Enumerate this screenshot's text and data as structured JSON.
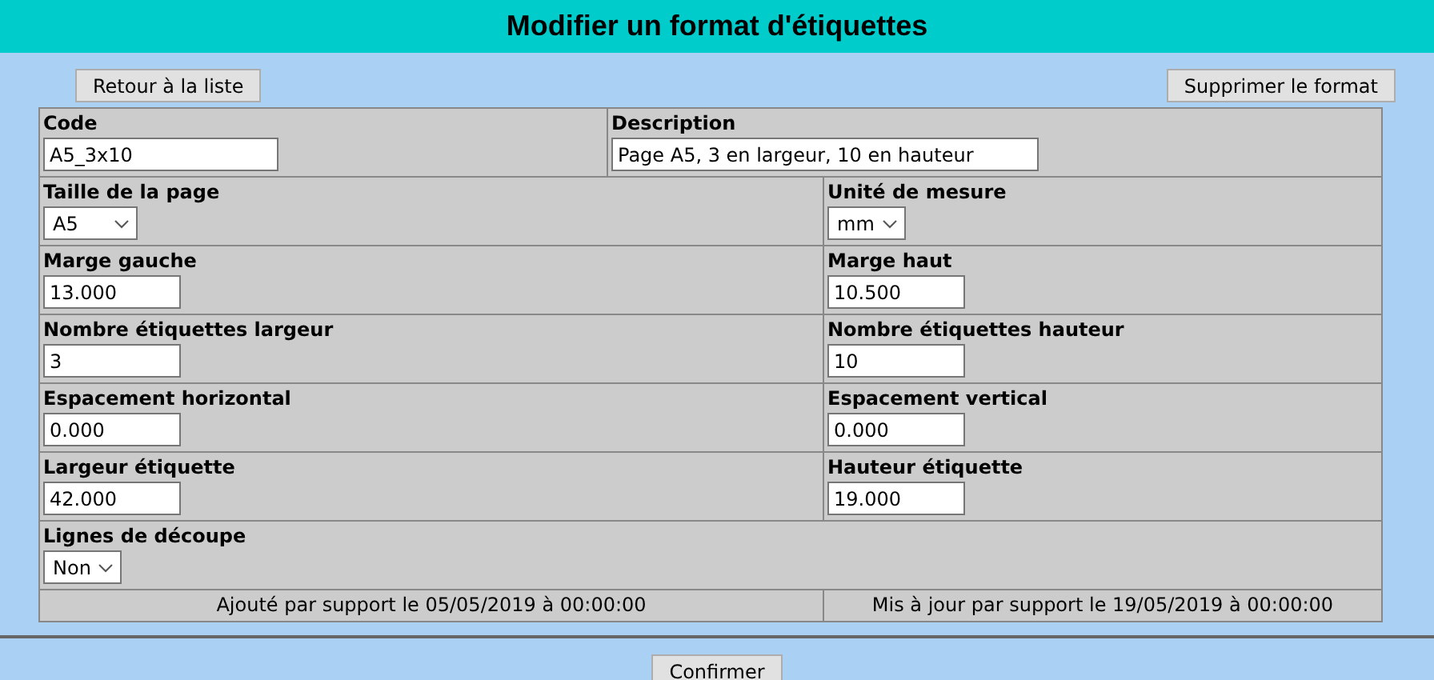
{
  "title": "Modifier un format d'étiquettes",
  "back_button": "Retour à la liste",
  "delete_button": "Supprimer le format",
  "rows": [
    {
      "kind": "header",
      "cells": [
        {
          "label": "Code",
          "kind": "text",
          "value": "A5_3x10"
        },
        {
          "label": "Description",
          "kind": "text",
          "value": "Page A5, 3 en largeur, 10 en hauteur"
        }
      ]
    },
    {
      "kind": "pair",
      "cells": [
        {
          "label": "Taille de la page",
          "kind": "select",
          "value": "A5"
        },
        {
          "label": "Unité de mesure",
          "kind": "select",
          "value": "mm"
        }
      ]
    },
    {
      "kind": "pair",
      "cells": [
        {
          "label": "Marge gauche",
          "kind": "text",
          "value": "13.000"
        },
        {
          "label": "Marge haut",
          "kind": "text",
          "value": "10.500"
        }
      ]
    },
    {
      "kind": "pair",
      "cells": [
        {
          "label": "Nombre étiquettes largeur",
          "kind": "text",
          "value": "3"
        },
        {
          "label": "Nombre étiquettes hauteur",
          "kind": "text",
          "value": "10"
        }
      ]
    },
    {
      "kind": "pair",
      "cells": [
        {
          "label": "Espacement horizontal",
          "kind": "text",
          "value": "0.000"
        },
        {
          "label": "Espacement vertical",
          "kind": "text",
          "value": "0.000"
        }
      ]
    },
    {
      "kind": "pair",
      "cells": [
        {
          "label": "Largeur étiquette",
          "kind": "text",
          "value": "42.000"
        },
        {
          "label": "Hauteur étiquette",
          "kind": "text",
          "value": "19.000"
        }
      ]
    },
    {
      "kind": "single",
      "cells": [
        {
          "label": "Lignes de découpe",
          "kind": "select",
          "value": "Non"
        }
      ]
    }
  ],
  "footer": [
    "Ajouté par support le 05/05/2019 à 00:00:00",
    "Mis à jour par support le 19/05/2019 à 00:00:00"
  ],
  "confirm_button": "Confirmer"
}
